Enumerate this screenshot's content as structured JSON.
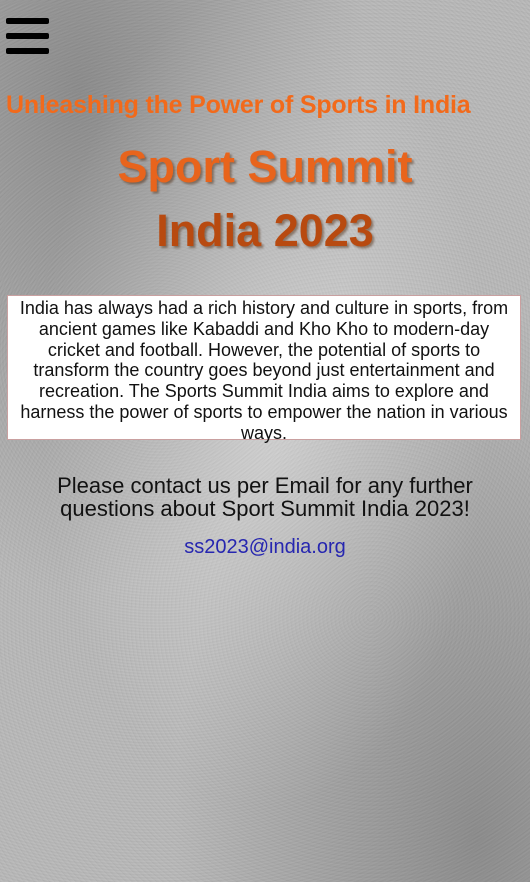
{
  "header": {
    "menu_icon": "hamburger-menu-icon"
  },
  "hero": {
    "tagline": "Unleashing the Power of Sports in India",
    "title_line1": "Sport Summit",
    "title_line2": "India 2023"
  },
  "intro": {
    "text": "India has always had a rich history and culture in sports, from ancient games like Kabaddi and Kho Kho to modern-day cricket and football. However, the potential of sports to transform the country goes beyond just entertainment and recreation. The Sports Summit India aims to explore and harness the power of sports to empower the nation in various ways."
  },
  "contact": {
    "text": "Please contact us per Email for any further questions about Sport Summit India 2023!",
    "email": "ss2023@india.org"
  },
  "colors": {
    "accent_orange": "#f26a1b",
    "title_dark_orange": "#b84a10",
    "link_blue": "#2626b0"
  }
}
